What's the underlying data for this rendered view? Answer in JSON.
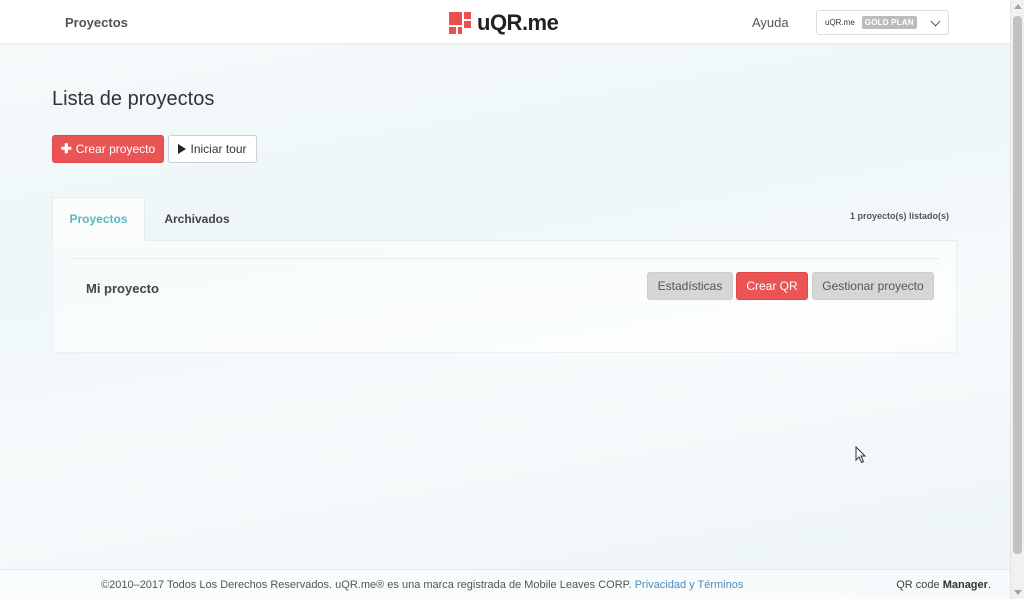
{
  "header": {
    "nav_projects": "Proyectos",
    "logo_text": "uQR.me",
    "help": "Ayuda",
    "account_name": "uQR.me",
    "plan_badge": "GOLD PLAN"
  },
  "main": {
    "title": "Lista de proyectos",
    "create_project_label": "Crear proyecto",
    "tour_label": "Iniciar tour",
    "tabs": [
      {
        "label": "Proyectos",
        "active": true
      },
      {
        "label": "Archivados",
        "active": false
      }
    ],
    "count_label": "1 proyecto(s) listado(s)",
    "projects": [
      {
        "name": "Mi proyecto",
        "stats_label": "Estadísticas",
        "create_qr_label": "Crear QR",
        "manage_label": "Gestionar proyecto"
      }
    ]
  },
  "footer": {
    "copyright": "©2010–2017 Todos Los Derechos Reservados. uQR.me® es una marca registrada de Mobile Leaves CORP.",
    "privacy_link": "Privacidad",
    "and": "y",
    "terms_link": "Términos",
    "brand_prefix": "QR code",
    "brand_bold": "Manager",
    "brand_suffix": "."
  },
  "colors": {
    "accent_red": "#ea5455",
    "tab_active": "#5bb8c0",
    "link": "#4d8fb5"
  },
  "icons": {
    "plus": "plus-icon",
    "play": "play-icon",
    "chevron": "chevron-down-icon",
    "logo": "logo-icon"
  }
}
